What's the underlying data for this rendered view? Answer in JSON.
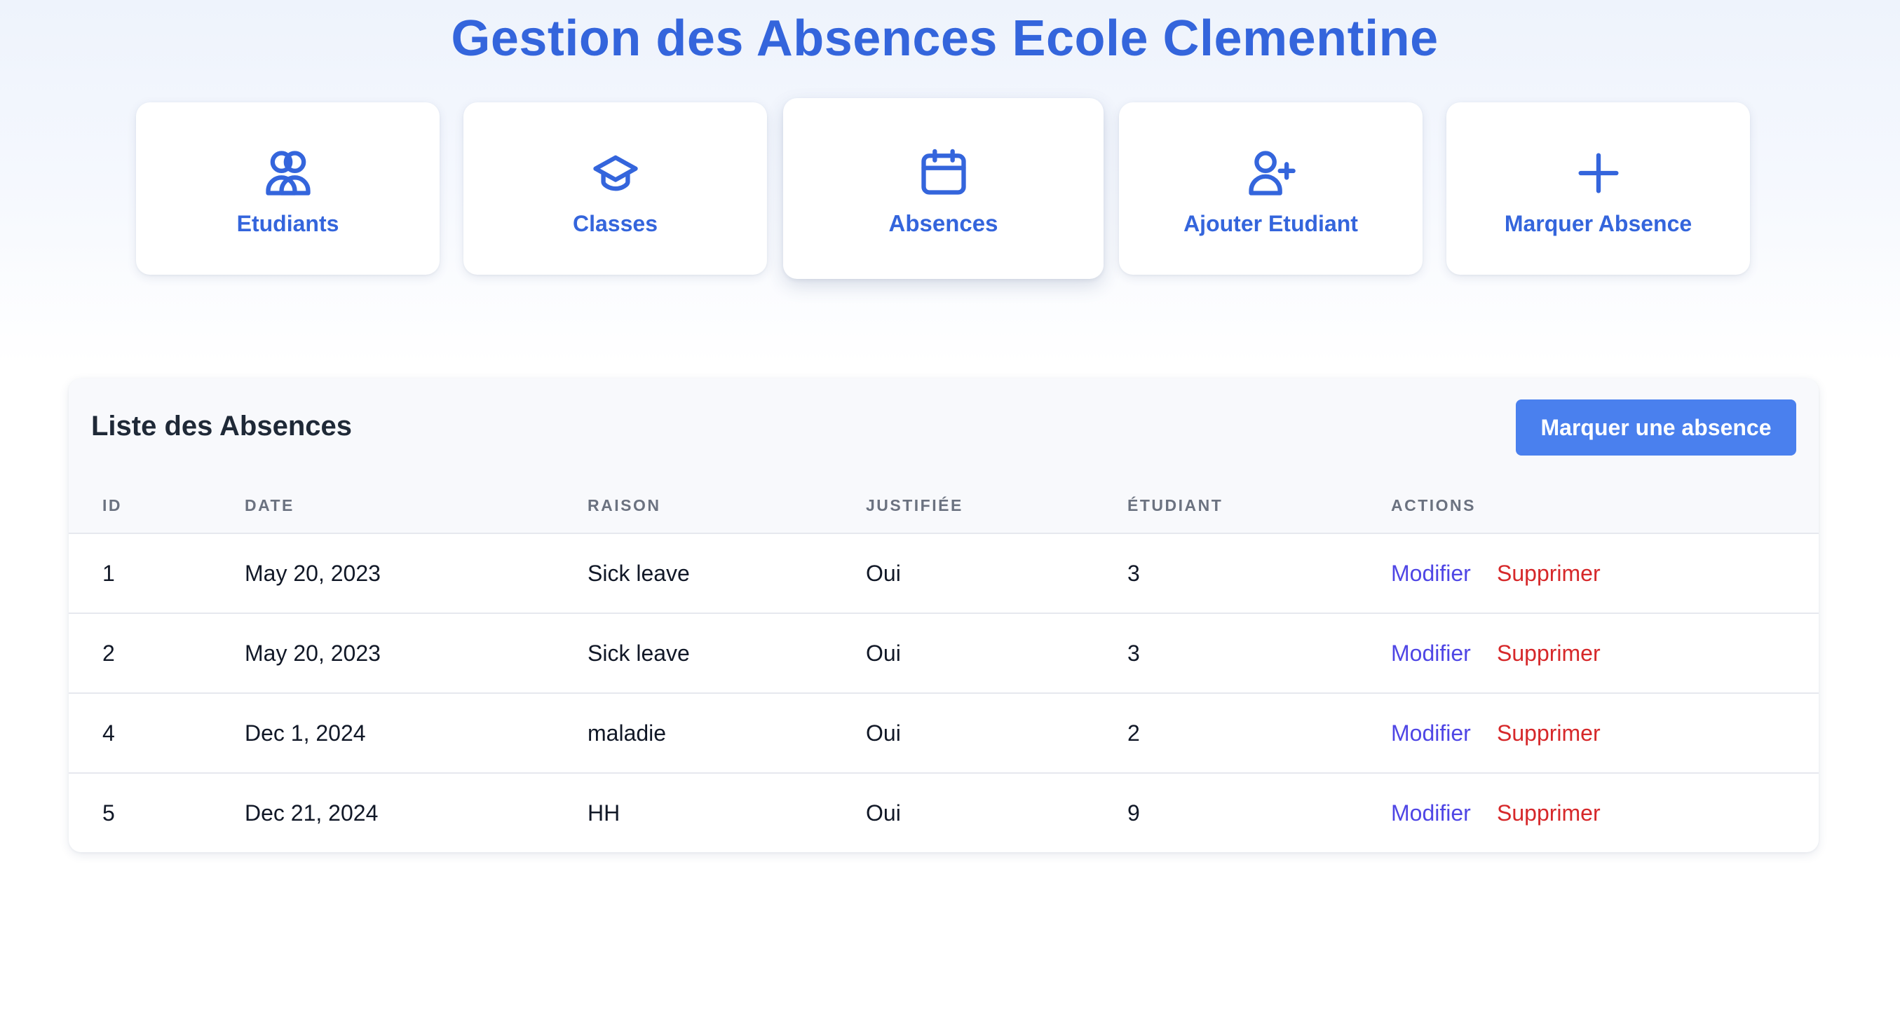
{
  "header": {
    "title": "Gestion des Absences Ecole Clementine"
  },
  "nav": {
    "items": [
      {
        "label": "Etudiants",
        "icon": "users-icon"
      },
      {
        "label": "Classes",
        "icon": "graduation-cap-icon"
      },
      {
        "label": "Absences",
        "icon": "calendar-icon",
        "active": true
      },
      {
        "label": "Ajouter Etudiant",
        "icon": "user-plus-icon"
      },
      {
        "label": "Marquer Absence",
        "icon": "plus-icon"
      }
    ]
  },
  "panel": {
    "title": "Liste des Absences",
    "primary_button": "Marquer une absence",
    "columns": [
      "ID",
      "DATE",
      "RAISON",
      "JUSTIFIÉE",
      "ÉTUDIANT",
      "ACTIONS"
    ],
    "rows": [
      {
        "id": "1",
        "date": "May 20, 2023",
        "reason": "Sick leave",
        "justified": "Oui",
        "student": "3"
      },
      {
        "id": "2",
        "date": "May 20, 2023",
        "reason": "Sick leave",
        "justified": "Oui",
        "student": "3"
      },
      {
        "id": "4",
        "date": "Dec 1, 2024",
        "reason": "maladie",
        "justified": "Oui",
        "student": "2"
      },
      {
        "id": "5",
        "date": "Dec 21, 2024",
        "reason": "HH",
        "justified": "Oui",
        "student": "9"
      }
    ],
    "actions": {
      "edit": "Modifier",
      "delete": "Supprimer"
    }
  },
  "colors": {
    "accent": "#3465dc",
    "primary_button": "#4a80ee",
    "edit_link": "#4f46e5",
    "delete_link": "#d6282a"
  }
}
